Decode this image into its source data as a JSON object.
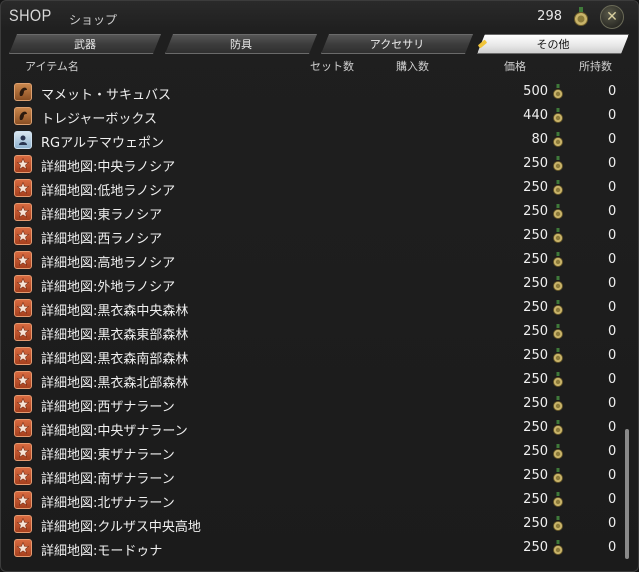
{
  "header": {
    "title": "SHOP",
    "subtitle": "ショップ",
    "currency_amount": "298",
    "currency_icon": "gil-coin-icon",
    "close_icon": "close-icon"
  },
  "tabs": [
    {
      "label": "武器",
      "active": false
    },
    {
      "label": "防具",
      "active": false
    },
    {
      "label": "アクセサリ",
      "active": false
    },
    {
      "label": "その他",
      "active": true
    }
  ],
  "columns": {
    "name": "アイテム名",
    "set": "セット数",
    "buy": "購入数",
    "price": "価格",
    "owned": "所持数"
  },
  "items": [
    {
      "name": "マメット・サキュバス",
      "price": "500",
      "owned": "0",
      "icon": "mount-icon"
    },
    {
      "name": "トレジャーボックス",
      "price": "440",
      "owned": "0",
      "icon": "mount-icon"
    },
    {
      "name": "RGアルテマウェポン",
      "price": "80",
      "owned": "0",
      "icon": "minion-icon"
    },
    {
      "name": "詳細地図:中央ラノシア",
      "price": "250",
      "owned": "0",
      "icon": "map-star-icon"
    },
    {
      "name": "詳細地図:低地ラノシア",
      "price": "250",
      "owned": "0",
      "icon": "map-star-icon"
    },
    {
      "name": "詳細地図:東ラノシア",
      "price": "250",
      "owned": "0",
      "icon": "map-star-icon"
    },
    {
      "name": "詳細地図:西ラノシア",
      "price": "250",
      "owned": "0",
      "icon": "map-star-icon"
    },
    {
      "name": "詳細地図:高地ラノシア",
      "price": "250",
      "owned": "0",
      "icon": "map-star-icon"
    },
    {
      "name": "詳細地図:外地ラノシア",
      "price": "250",
      "owned": "0",
      "icon": "map-star-icon"
    },
    {
      "name": "詳細地図:黒衣森中央森林",
      "price": "250",
      "owned": "0",
      "icon": "map-star-icon"
    },
    {
      "name": "詳細地図:黒衣森東部森林",
      "price": "250",
      "owned": "0",
      "icon": "map-star-icon"
    },
    {
      "name": "詳細地図:黒衣森南部森林",
      "price": "250",
      "owned": "0",
      "icon": "map-star-icon"
    },
    {
      "name": "詳細地図:黒衣森北部森林",
      "price": "250",
      "owned": "0",
      "icon": "map-star-icon"
    },
    {
      "name": "詳細地図:西ザナラーン",
      "price": "250",
      "owned": "0",
      "icon": "map-star-icon"
    },
    {
      "name": "詳細地図:中央ザナラーン",
      "price": "250",
      "owned": "0",
      "icon": "map-star-icon"
    },
    {
      "name": "詳細地図:東ザナラーン",
      "price": "250",
      "owned": "0",
      "icon": "map-star-icon"
    },
    {
      "name": "詳細地図:南ザナラーン",
      "price": "250",
      "owned": "0",
      "icon": "map-star-icon"
    },
    {
      "name": "詳細地図:北ザナラーン",
      "price": "250",
      "owned": "0",
      "icon": "map-star-icon"
    },
    {
      "name": "詳細地図:クルザス中央高地",
      "price": "250",
      "owned": "0",
      "icon": "map-star-icon"
    },
    {
      "name": "詳細地図:モードゥナ",
      "price": "250",
      "owned": "0",
      "icon": "map-star-icon"
    }
  ],
  "colors": {
    "background": "#1b1b1b",
    "active_tab": "#ffffff",
    "tab_marker": "#f0c43a",
    "map_icon": "#c8552c"
  }
}
